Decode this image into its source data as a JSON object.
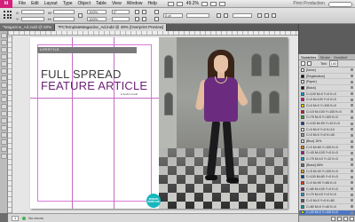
{
  "menubar": {
    "logo": "Id",
    "items": [
      "File",
      "Edit",
      "Layout",
      "Type",
      "Object",
      "Table",
      "View",
      "Window",
      "Help"
    ],
    "zoom": "49.2%",
    "workspace": "Print Production"
  },
  "controlbar": {
    "x_label": "X:",
    "y_label": "Y:",
    "w_label": "W:",
    "h_label": "H:",
    "stroke_weight": "0 pt",
    "percent_a": "100%",
    "percent_b": "100%",
    "angle": "0°"
  },
  "tabs": [
    {
      "label": "*Magazine_Ad.indd @ 50%"
    },
    {
      "label": "*PCTemplateMagazine_Ad.indd @ 49% [Overprint Preview]"
    }
  ],
  "spread": {
    "section_label": "LIFESTYLE",
    "headline_line1": "FULL SPREAD",
    "headline_line2": "FEATURE ARTICLE",
    "byline": "& Author Credit",
    "badge_text": "SPREAD TEMPLATE"
  },
  "statusbar": {
    "page": "1",
    "status": "No errors"
  },
  "swatches_panel": {
    "tabs": [
      "Swatches",
      "Stroke",
      "Gradient"
    ],
    "tint_label": "Tint:",
    "tint_value": "100",
    "swatches": [
      {
        "name": "[None]",
        "color": "#ffffff"
      },
      {
        "name": "[Registration]",
        "color": "#000000"
      },
      {
        "name": "[Paper]",
        "color": "#ffffff"
      },
      {
        "name": "[Black]",
        "color": "#000000"
      },
      {
        "name": "C=100 M=0 Y=0 K=0",
        "color": "#00a6e4"
      },
      {
        "name": "C=0 M=100 Y=0 K=0",
        "color": "#e6007e"
      },
      {
        "name": "C=0 M=0 Y=100 K=0",
        "color": "#ffed00"
      },
      {
        "name": "C=15 M=100 Y=100 K=0",
        "color": "#c8102e"
      },
      {
        "name": "C=75 M=5 Y=100 K=0",
        "color": "#3aa935"
      },
      {
        "name": "C=100 M=90 Y=10 K=0",
        "color": "#1f3b8f"
      },
      {
        "name": "C=0 M=0 Y=0 K=10",
        "color": "#e6e6e6"
      },
      {
        "name": "C=0 M=0 Y=0 K=40",
        "color": "#9d9d9c"
      },
      {
        "name": "[Blue] 15%",
        "color": "#d5e4f5"
      },
      {
        "name": "C=0 M=60 Y=100 K=0",
        "color": "#ef7d00"
      },
      {
        "name": "C=40 M=100 Y=0 K=0",
        "color": "#9b1e83"
      },
      {
        "name": "C=75 M=10 Y=12 K=0",
        "color": "#159dcb"
      },
      {
        "name": "[Black] 65%",
        "color": "#6f6f6e"
      },
      {
        "name": "C=5 M=40 Y=100 K=0",
        "color": "#f2a900"
      },
      {
        "name": "C=100 M=80 Y=0 K=0",
        "color": "#123c8c"
      },
      {
        "name": "C=0 M=90 Y=85 K=0",
        "color": "#e53424"
      },
      {
        "name": "C=65 M=100 Y=0 K=0",
        "color": "#6b2c7f"
      },
      {
        "name": "C=70 M=15 Y=0 K=0",
        "color": "#2fa3dc"
      },
      {
        "name": "C=0 M=0 Y=0 K=80",
        "color": "#575756"
      },
      {
        "name": "C=80 M=0 Y=40 K=0",
        "color": "#00a6a0"
      },
      {
        "name": "C=20 M=0 Y=100 K=0",
        "color": "#d6df00"
      }
    ],
    "selected_index": 24
  }
}
